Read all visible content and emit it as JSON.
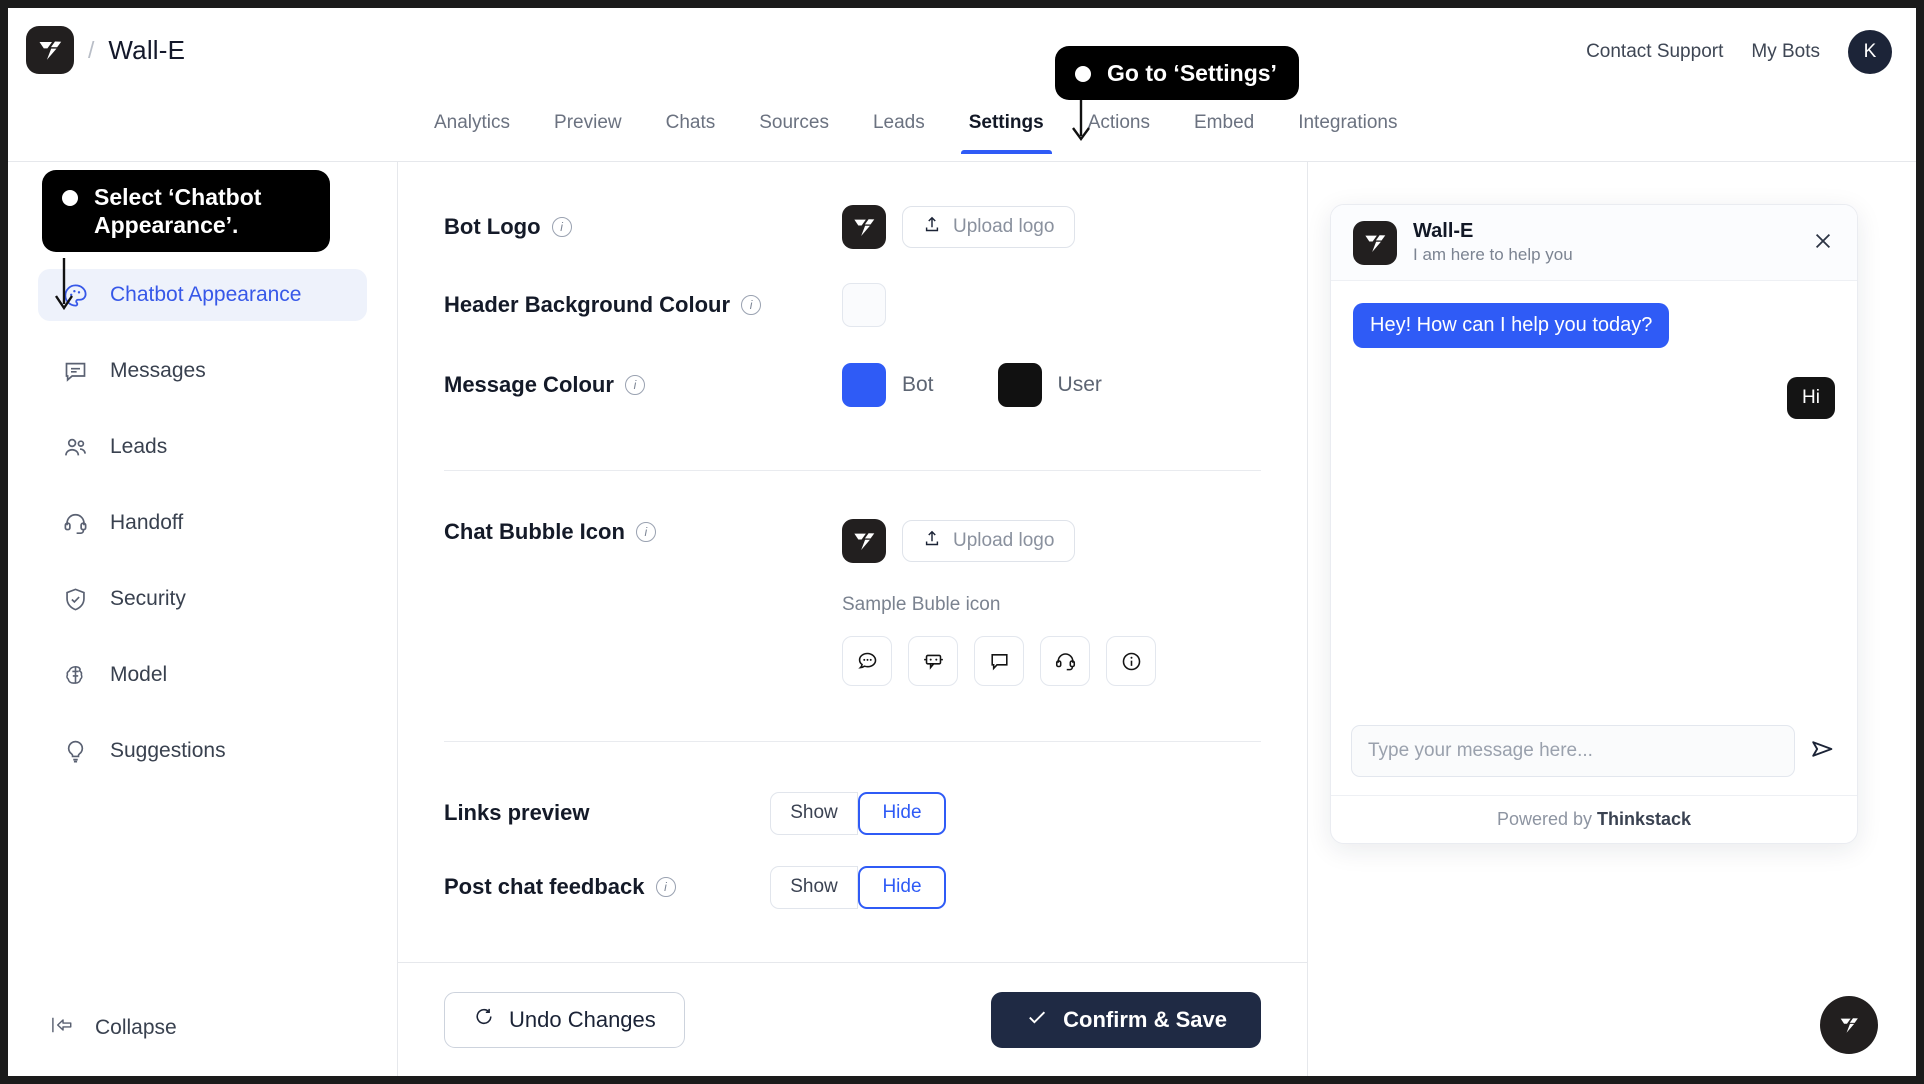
{
  "topbar": {
    "logo_icon": "thinkstack-logo-icon",
    "separator": "/",
    "bot_name": "Wall-E",
    "contact_support": "Contact Support",
    "my_bots": "My Bots",
    "avatar_initial": "K"
  },
  "nav": {
    "tabs": [
      {
        "label": "Analytics",
        "active": false
      },
      {
        "label": "Preview",
        "active": false
      },
      {
        "label": "Chats",
        "active": false
      },
      {
        "label": "Sources",
        "active": false
      },
      {
        "label": "Leads",
        "active": false
      },
      {
        "label": "Settings",
        "active": true
      },
      {
        "label": "Actions",
        "active": false
      },
      {
        "label": "Embed",
        "active": false
      },
      {
        "label": "Integrations",
        "active": false
      }
    ]
  },
  "sidebar": {
    "items": [
      {
        "label": "Chatbot Appearance",
        "icon": "palette-icon",
        "active": true
      },
      {
        "label": "Messages",
        "icon": "message-icon",
        "active": false
      },
      {
        "label": "Leads",
        "icon": "users-icon",
        "active": false
      },
      {
        "label": "Handoff",
        "icon": "headset-icon",
        "active": false
      },
      {
        "label": "Security",
        "icon": "shield-check-icon",
        "active": false
      },
      {
        "label": "Model",
        "icon": "brain-icon",
        "active": false
      },
      {
        "label": "Suggestions",
        "icon": "lightbulb-icon",
        "active": false
      }
    ],
    "collapse_label": "Collapse",
    "collapse_icon": "collapse-left-icon"
  },
  "settings": {
    "bot_logo": {
      "label": "Bot Logo",
      "has_info": true,
      "upload_label": "Upload logo",
      "upload_icon": "upload-icon",
      "preview_icon": "thinkstack-logo-icon"
    },
    "header_bg": {
      "label": "Header Background Colour",
      "has_info": true,
      "color": "#FAFBFD"
    },
    "message_colour": {
      "label": "Message Colour",
      "has_info": true,
      "bot_label": "Bot",
      "bot_color": "#2F5BF6",
      "user_label": "User",
      "user_color": "#111111"
    },
    "chat_bubble_icon": {
      "label": "Chat Bubble Icon",
      "has_info": true,
      "upload_label": "Upload logo",
      "upload_icon": "upload-icon",
      "preview_icon": "thinkstack-logo-icon",
      "sample_label": "Sample Buble icon",
      "samples": [
        "chat-dots-icon",
        "robot-chat-icon",
        "speech-bubble-icon",
        "headset-icon",
        "info-circle-icon"
      ]
    },
    "links_preview": {
      "label": "Links preview",
      "has_info": false,
      "options": [
        "Show",
        "Hide"
      ],
      "selected": "Hide"
    },
    "post_chat_feedback": {
      "label": "Post chat feedback",
      "has_info": true,
      "options": [
        "Show",
        "Hide"
      ],
      "selected": "Hide"
    }
  },
  "footer": {
    "undo_label": "Undo Changes",
    "undo_icon": "undo-rotate-icon",
    "save_label": "Confirm & Save",
    "save_icon": "check-icon"
  },
  "preview": {
    "bot_name": "Wall-E",
    "bot_tagline": "I am here to help you",
    "close_icon": "close-icon",
    "bot_message": "Hey! How can I help you today?",
    "user_message": "Hi",
    "input_placeholder": "Type your message here...",
    "send_icon": "send-icon",
    "powered_prefix": "Powered by",
    "powered_brand": "Thinkstack",
    "launcher_icon": "thinkstack-logo-icon"
  },
  "coach_marks": {
    "settings_tip": "Go to ‘Settings’",
    "sidebar_tip": "Select ‘Chatbot Appearance’."
  },
  "colors": {
    "accent_blue": "#2F5BF6",
    "sidebar_active_bg": "#EEF2FB",
    "sidebar_active_text": "#3758E8",
    "dark_navy": "#1F2A44",
    "logo_black": "#221F1F"
  }
}
